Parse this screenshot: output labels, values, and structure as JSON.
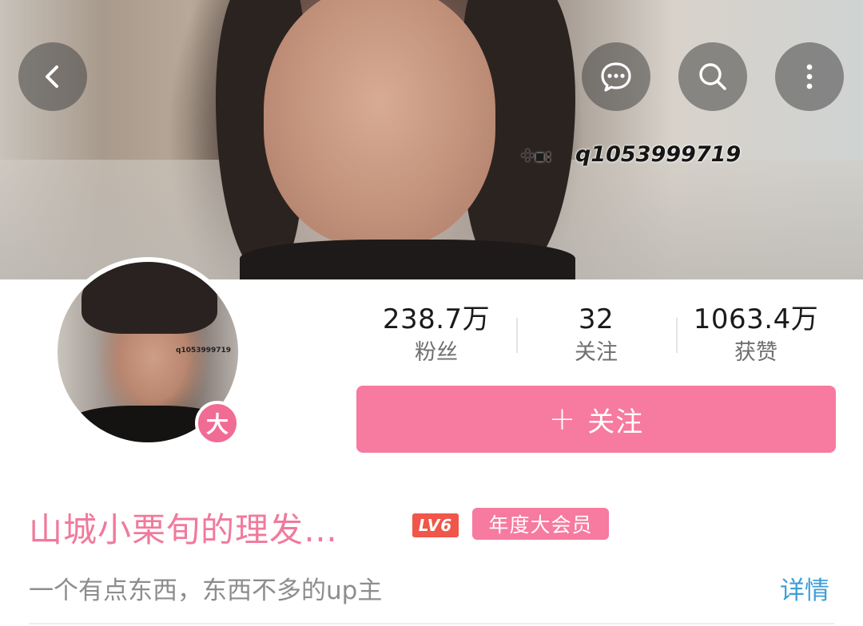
{
  "banner": {
    "overlay_text": "q1053999719",
    "overlay_icon": "⁘▪:"
  },
  "top_bar": {
    "back_icon": "chevron-left-icon",
    "message_icon": "chat-bubble-icon",
    "search_icon": "search-icon",
    "more_icon": "more-vertical-icon"
  },
  "avatar": {
    "overlay_text": "q1053999719",
    "badge": "大"
  },
  "stats": [
    {
      "value": "238.7万",
      "label": "粉丝"
    },
    {
      "value": "32",
      "label": "关注"
    },
    {
      "value": "1063.4万",
      "label": "获赞"
    }
  ],
  "follow_button": {
    "plus": "+",
    "label": "关注"
  },
  "profile": {
    "username": "山城小栗旬的理发…",
    "level": "LV6",
    "vip": "年度大会员",
    "bio": "一个有点东西，东西不多的up主",
    "detail": "详情"
  },
  "colors": {
    "accent": "#f77aa0",
    "username": "#f07a9c",
    "level": "#f0564a",
    "link": "#3d9ed6"
  }
}
